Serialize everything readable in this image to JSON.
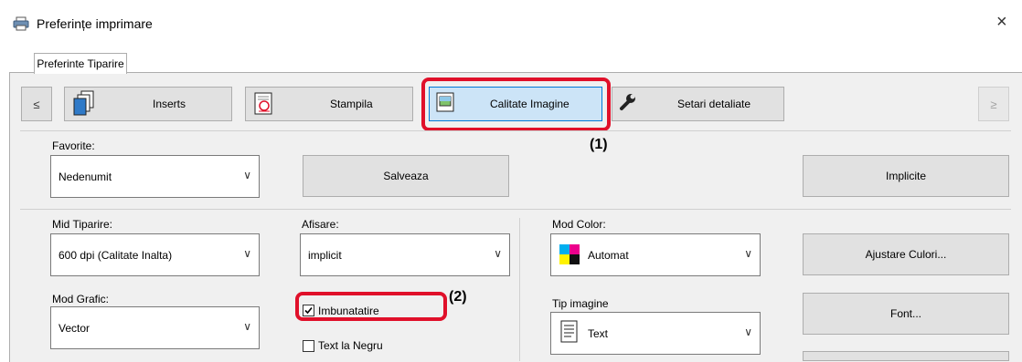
{
  "window": {
    "title": "Preferințe imprimare",
    "close_glyph": "×"
  },
  "tab": {
    "label": "Preferinte Tiparire"
  },
  "toolbar": {
    "prev_label": "≤",
    "next_label": "≥",
    "buttons": [
      {
        "label": "Inserts",
        "icon": "inserts-icon"
      },
      {
        "label": "Stampila",
        "icon": "stamp-icon"
      },
      {
        "label": "Calitate Imagine",
        "icon": "image-quality-icon",
        "selected": true
      },
      {
        "label": "Setari detaliate",
        "icon": "wrench-icon"
      }
    ]
  },
  "callouts": {
    "one": "(1)",
    "two": "(2)"
  },
  "favorites": {
    "label": "Favorite:",
    "value": "Nedenumit",
    "save_label": "Salveaza",
    "default_label": "Implicite"
  },
  "print_mode": {
    "label": "Mid Tiparire:",
    "value": "600 dpi (Calitate Inalta)"
  },
  "display": {
    "label": "Afisare:",
    "value": "implicit"
  },
  "color_mode": {
    "label": "Mod Color:",
    "value": "Automat",
    "adjust_label": "Ajustare Culori..."
  },
  "graphics_mode": {
    "label": "Mod Grafic:",
    "value": "Vector"
  },
  "enhance": {
    "label": "Imbunatatire",
    "checked": true
  },
  "text_black": {
    "label": "Text la Negru",
    "checked": false
  },
  "image_type": {
    "label": "Tip imagine",
    "value": "Text"
  },
  "font": {
    "label": "Font..."
  },
  "colors": {
    "accent_red": "#e0102a",
    "selected_bg": "#cce4f7",
    "selected_border": "#0078d7"
  }
}
